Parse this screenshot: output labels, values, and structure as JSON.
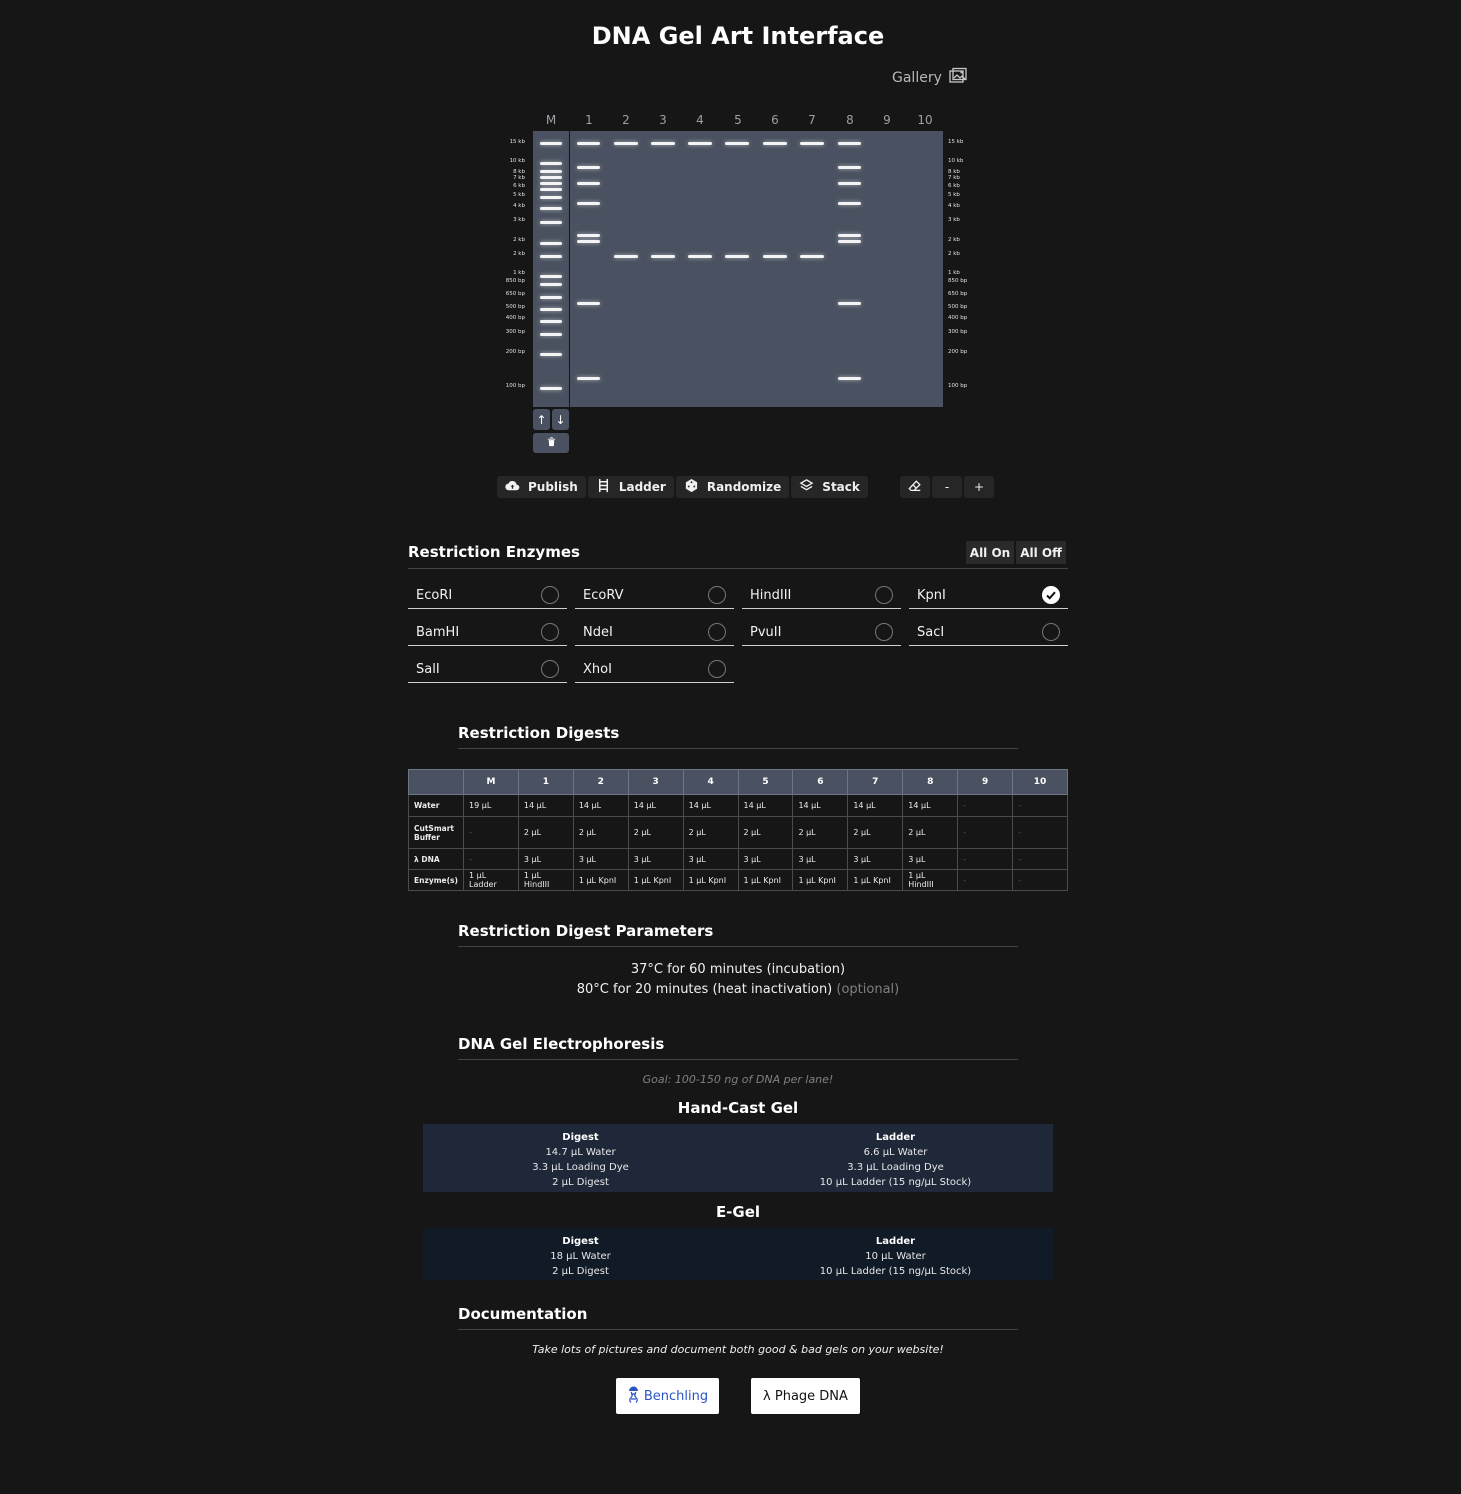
{
  "page": {
    "title": "DNA Gel Art Interface",
    "gallery_label": "Gallery"
  },
  "gel": {
    "lane_labels": [
      "M",
      "1",
      "2",
      "3",
      "4",
      "5",
      "6",
      "7",
      "8",
      "9",
      "10"
    ],
    "size_labels": [
      "15 kb",
      "10 kb",
      "8 kb",
      "7 kb",
      "6 kb",
      "5 kb",
      "4 kb",
      "3 kb",
      "2 kb",
      "2 kb",
      "1 kb",
      "850 bp",
      "650 bp",
      "500 bp",
      "400 bp",
      "300 bp",
      "200 bp",
      "100 bp"
    ],
    "move_up_label": "↑",
    "move_down_label": "↓",
    "band_color": "#f4f4f4",
    "gel_color": "#4a5261"
  },
  "toolbar": {
    "publish": "Publish",
    "ladder": "Ladder",
    "randomize": "Randomize",
    "stack": "Stack",
    "zoom_out": "-",
    "zoom_in": "+"
  },
  "enzymes": {
    "title": "Restriction Enzymes",
    "all_on": "All On",
    "all_off": "All Off",
    "items": [
      {
        "name": "EcoRI",
        "checked": false
      },
      {
        "name": "EcoRV",
        "checked": false
      },
      {
        "name": "HindIII",
        "checked": false
      },
      {
        "name": "KpnI",
        "checked": true
      },
      {
        "name": "BamHI",
        "checked": false
      },
      {
        "name": "NdeI",
        "checked": false
      },
      {
        "name": "PvuII",
        "checked": false
      },
      {
        "name": "SacI",
        "checked": false
      },
      {
        "name": "SalI",
        "checked": false
      },
      {
        "name": "XhoI",
        "checked": false
      }
    ]
  },
  "digests": {
    "title": "Restriction Digests",
    "columns": [
      "",
      "M",
      "1",
      "2",
      "3",
      "4",
      "5",
      "6",
      "7",
      "8",
      "9",
      "10"
    ],
    "rows": [
      {
        "label": "Water",
        "cells": [
          "19 µL",
          "14 µL",
          "14 µL",
          "14 µL",
          "14 µL",
          "14 µL",
          "14 µL",
          "14 µL",
          "14 µL",
          "-",
          "-"
        ]
      },
      {
        "label": "CutSmart Buffer",
        "cells": [
          "-",
          "2 µL",
          "2 µL",
          "2 µL",
          "2 µL",
          "2 µL",
          "2 µL",
          "2 µL",
          "2 µL",
          "-",
          "-"
        ]
      },
      {
        "label": "λ DNA",
        "cells": [
          "-",
          "3 µL",
          "3 µL",
          "3 µL",
          "3 µL",
          "3 µL",
          "3 µL",
          "3 µL",
          "3 µL",
          "-",
          "-"
        ]
      },
      {
        "label": "Enzyme(s)",
        "cells": [
          "1 µL Ladder",
          "1 µL HindIII",
          "1 µL KpnI",
          "1 µL KpnI",
          "1 µL KpnI",
          "1 µL KpnI",
          "1 µL KpnI",
          "1 µL KpnI",
          "1 µL HindIII",
          "-",
          "-"
        ]
      }
    ]
  },
  "parameters": {
    "title": "Restriction Digest Parameters",
    "line1": "37°C for 60 minutes (incubation)",
    "line2": "80°C for 20 minutes (heat inactivation)",
    "line2_optional": "(optional)"
  },
  "electrophoresis": {
    "title": "DNA Gel Electrophoresis",
    "goal": "Goal: 100-150 ng of DNA per lane!",
    "handcast": {
      "title": "Hand-Cast Gel",
      "color": "#1e2838",
      "digest": {
        "header": "Digest",
        "lines": [
          "14.7 µL Water",
          "3.3 µL Loading Dye",
          "2 µL Digest"
        ]
      },
      "ladder": {
        "header": "Ladder",
        "lines": [
          "6.6 µL Water",
          "3.3 µL Loading Dye",
          "10 µL Ladder (15 ng/µL Stock)"
        ]
      }
    },
    "egel": {
      "title": "E-Gel",
      "color": "#111a27",
      "digest": {
        "header": "Digest",
        "lines": [
          "18 µL Water",
          "2 µL Digest"
        ]
      },
      "ladder": {
        "header": "Ladder",
        "lines": [
          "10 µL Water",
          "10 µL Ladder (15 ng/µL Stock)"
        ]
      }
    }
  },
  "documentation": {
    "title": "Documentation",
    "note": "Take lots of pictures and document both good & bad gels on your website!",
    "benchling": "Benchling",
    "benchling_color": "#2a55c5",
    "phage": "λ Phage DNA"
  }
}
